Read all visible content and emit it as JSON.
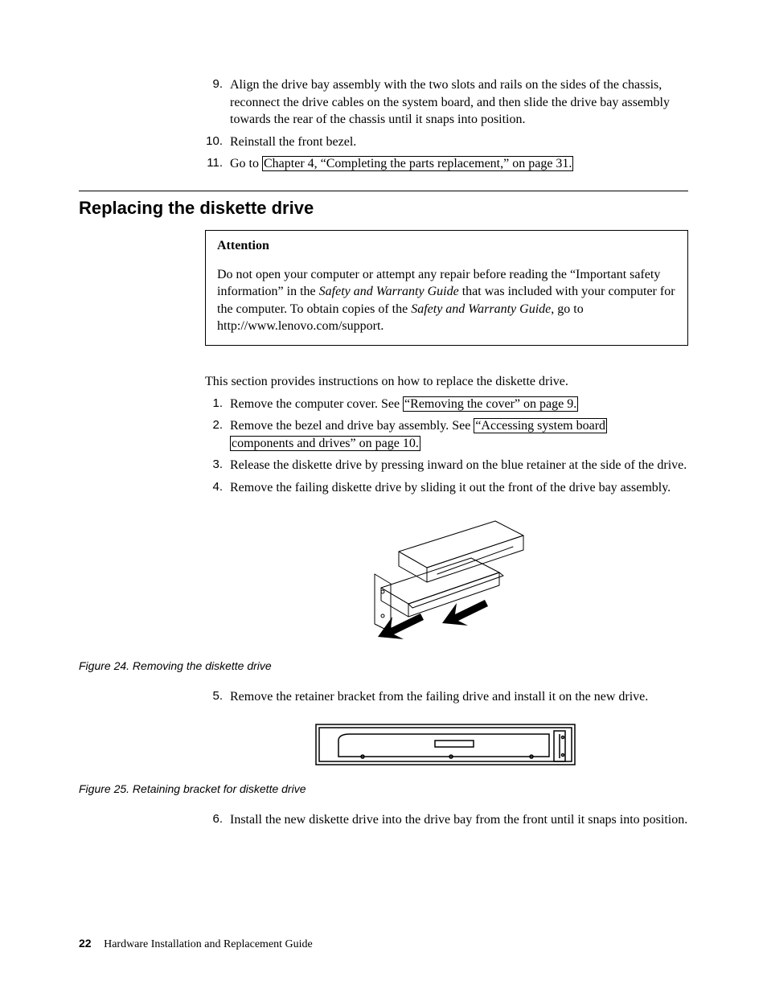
{
  "top_list": {
    "item9": {
      "num": "9.",
      "text": "Align the drive bay assembly with the two slots and rails on the sides of the chassis, reconnect the drive cables on the system board, and then slide the drive bay assembly towards the rear of the chassis until it snaps into position."
    },
    "item10": {
      "num": "10.",
      "text": "Reinstall the front bezel."
    },
    "item11": {
      "num": "11.",
      "pre": "Go to ",
      "link": "Chapter 4, “Completing the parts replacement,” on page 31."
    }
  },
  "section_heading": "Replacing the diskette drive",
  "attention": {
    "title": "Attention",
    "p_pre": "Do not open your computer or attempt any repair before reading the “Important safety information” in the ",
    "p_i1": "Safety and Warranty Guide",
    "p_mid": " that was included with your computer for the computer. To obtain copies of the ",
    "p_i2": "Safety and Warranty Guide",
    "p_post": ", go to http://www.lenovo.com/support."
  },
  "intro": "This section provides instructions on how to replace the diskette drive.",
  "steps": {
    "s1": {
      "num": "1.",
      "pre": "Remove the computer cover. See ",
      "link": "“Removing the cover” on page 9."
    },
    "s2": {
      "num": "2.",
      "pre": "Remove the bezel and drive bay assembly. See ",
      "linkA": "“Accessing system board",
      "linkB": "components and drives” on page 10."
    },
    "s3": {
      "num": "3.",
      "text": "Release the diskette drive by pressing inward on the blue retainer at the side of the drive."
    },
    "s4": {
      "num": "4.",
      "text": "Remove the failing diskette drive by sliding it out the front of the drive bay assembly."
    },
    "s5": {
      "num": "5.",
      "text": "Remove the retainer bracket from the failing drive and install it on the new drive."
    },
    "s6": {
      "num": "6.",
      "text": "Install the new diskette drive into the drive bay from the front until it snaps into position."
    }
  },
  "fig24": "Figure 24. Removing the diskette drive",
  "fig25": "Figure 25. Retaining bracket for diskette drive",
  "footer": {
    "page": "22",
    "title": "Hardware Installation and Replacement Guide"
  }
}
